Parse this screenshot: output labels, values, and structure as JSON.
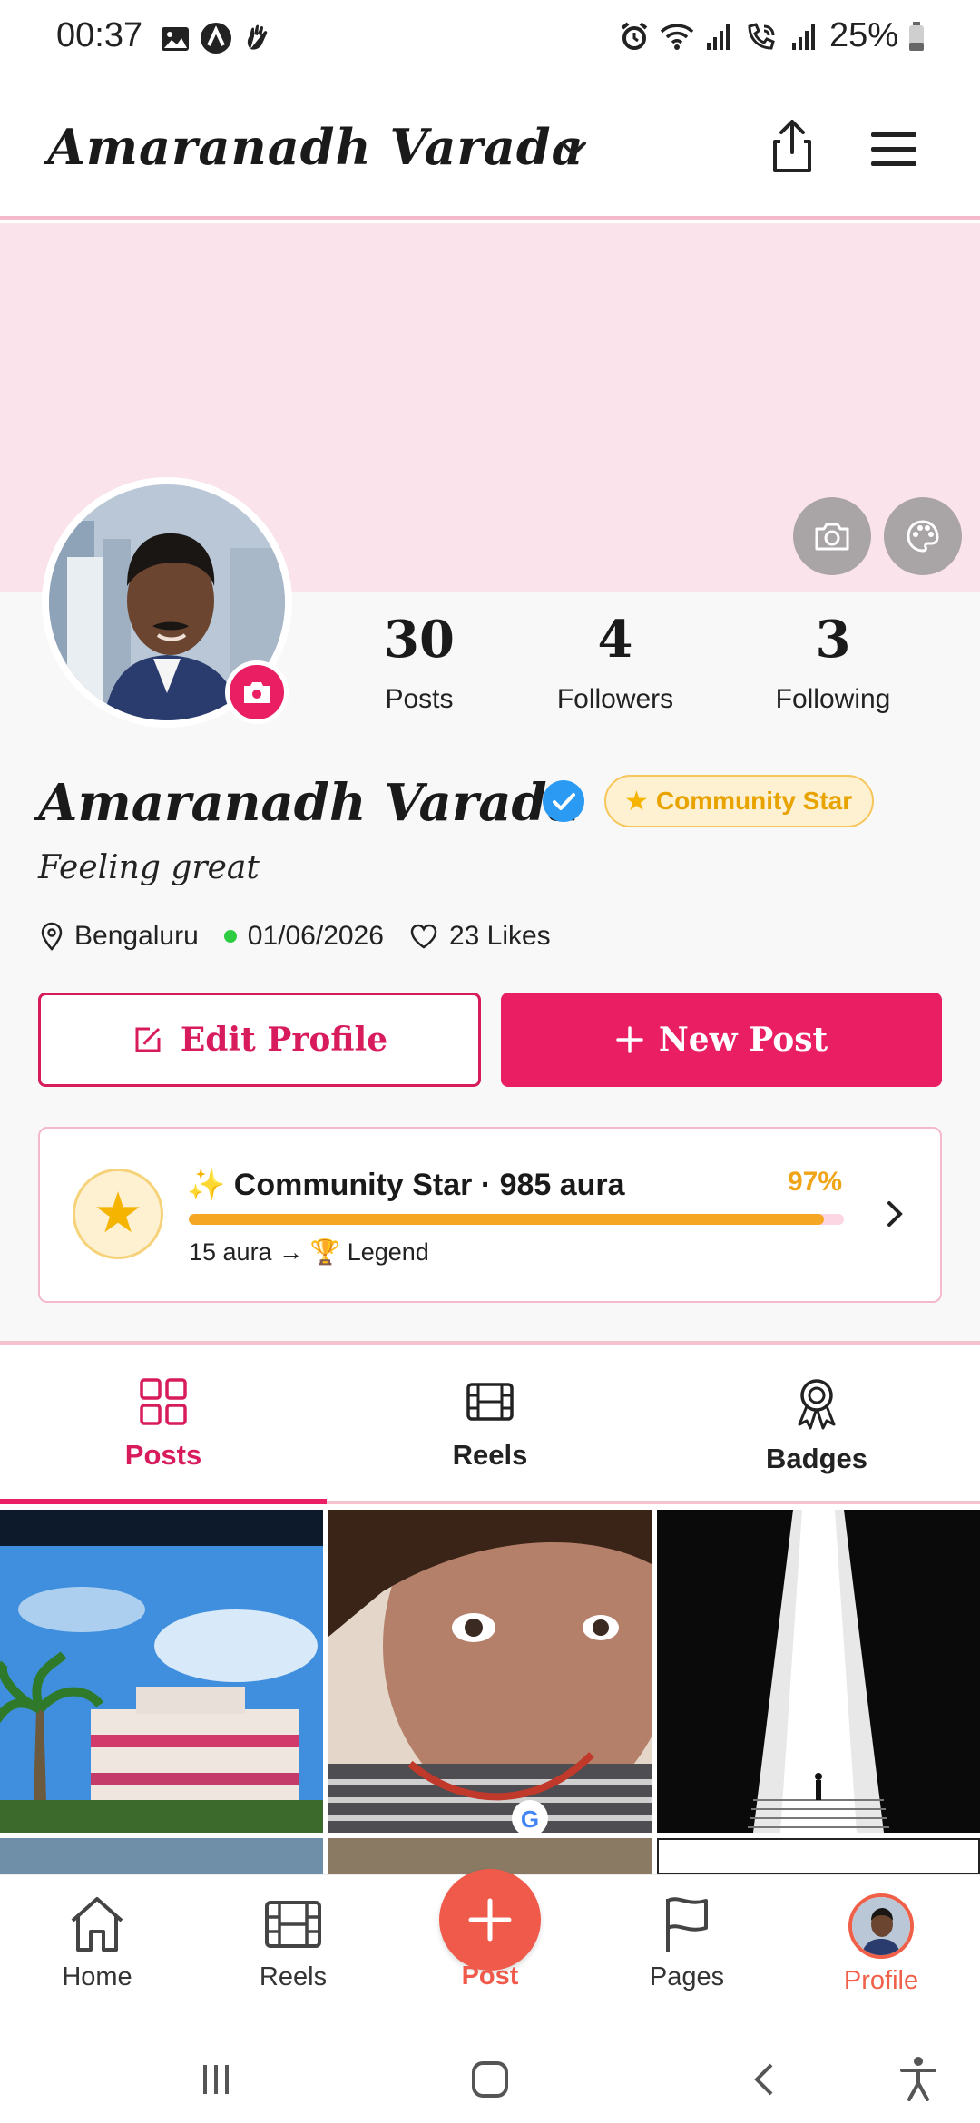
{
  "status_bar": {
    "time": "00:37",
    "battery": "25%",
    "left_icons": [
      "gallery-icon",
      "app-a-icon",
      "hand-icon"
    ],
    "right_icons": [
      "alarm-icon",
      "wifi-icon",
      "signal-icon",
      "wifi-calling-icon",
      "signal-icon",
      "battery-icon"
    ]
  },
  "header": {
    "username": "Amaranadh Varada",
    "icons": [
      "chevron-down-icon",
      "share-icon",
      "menu-icon"
    ]
  },
  "cover": {
    "background_color": "#fae3ea",
    "icons": [
      "camera-icon",
      "palette-icon"
    ]
  },
  "stats": {
    "posts": {
      "value": "30",
      "label": "Posts"
    },
    "followers": {
      "value": "4",
      "label": "Followers"
    },
    "following": {
      "value": "3",
      "label": "Following"
    }
  },
  "profile": {
    "name": "Amaranadh Varada",
    "verified": true,
    "badge": "Community Star",
    "bio": "Feeling great",
    "location": "Bengaluru",
    "date": "01/06/2026",
    "likes": "23 Likes"
  },
  "actions": {
    "edit_profile": "Edit Profile",
    "new_post": "New Post"
  },
  "aura": {
    "title": "✨ Community Star · 985 aura",
    "percent_label": "97%",
    "progress": 0.97,
    "next_level": "15 aura → 🏆 Legend"
  },
  "tabs": [
    {
      "label": "Posts",
      "icon": "grid-icon",
      "active": true
    },
    {
      "label": "Reels",
      "icon": "film-icon",
      "active": false
    },
    {
      "label": "Badges",
      "icon": "award-icon",
      "active": false
    }
  ],
  "bottom_nav": {
    "home": "Home",
    "reels": "Reels",
    "post": "Post",
    "pages": "Pages",
    "profile": "Profile"
  },
  "colors": {
    "accent": "#e91e63",
    "nav_accent": "#f05a4a",
    "gold": "#f5a623",
    "verified": "#2b9af3"
  }
}
